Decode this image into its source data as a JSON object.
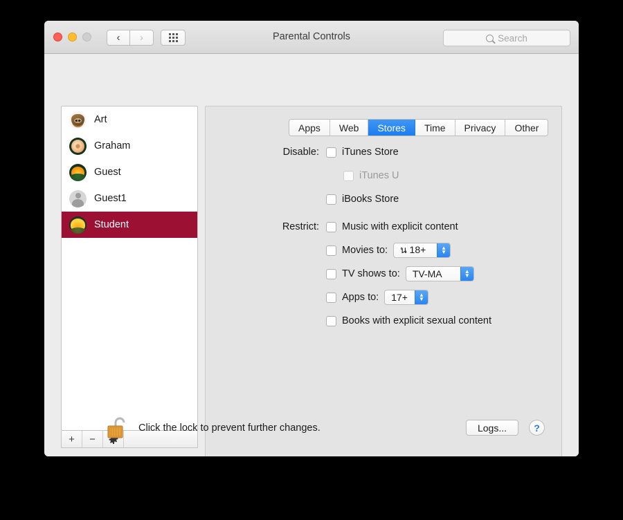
{
  "window": {
    "title": "Parental Controls",
    "traffic_lights": [
      "close",
      "minimize",
      "zoom"
    ],
    "nav_back_icon": "chevron-left-icon",
    "nav_forward_icon": "chevron-right-icon",
    "grid_icon": "show-all-grid-icon"
  },
  "search": {
    "placeholder": "Search",
    "value": "",
    "icon": "search-icon"
  },
  "sidebar": {
    "users": [
      {
        "name": "Art",
        "avatar": "cat-avatar",
        "selected": false
      },
      {
        "name": "Graham",
        "avatar": "rose-avatar",
        "selected": false
      },
      {
        "name": "Guest",
        "avatar": "poppy-avatar",
        "selected": false
      },
      {
        "name": "Guest1",
        "avatar": "person-avatar",
        "selected": false
      },
      {
        "name": "Student",
        "avatar": "sunflower-avatar",
        "selected": true
      }
    ],
    "selection_color": "#9c1033",
    "toolbar": {
      "add_label": "+",
      "remove_label": "−",
      "action_icon": "gear-icon"
    }
  },
  "tabs": [
    {
      "label": "Apps",
      "active": false
    },
    {
      "label": "Web",
      "active": false
    },
    {
      "label": "Stores",
      "active": true
    },
    {
      "label": "Time",
      "active": false
    },
    {
      "label": "Privacy",
      "active": false
    },
    {
      "label": "Other",
      "active": false
    }
  ],
  "tab_active_color": "#1d7ded",
  "stores": {
    "disable_label": "Disable:",
    "disable_items": [
      {
        "label": "iTunes Store",
        "checked": false,
        "enabled": true,
        "indented": false
      },
      {
        "label": "iTunes U",
        "checked": false,
        "enabled": false,
        "indented": true
      },
      {
        "label": "iBooks Store",
        "checked": false,
        "enabled": true,
        "indented": false
      }
    ],
    "restrict_label": "Restrict:",
    "restrict_items": [
      {
        "label": "Music with explicit content",
        "checked": false,
        "popup": null
      },
      {
        "label": "Movies to:",
        "checked": false,
        "popup": "น 18+"
      },
      {
        "label": "TV shows to:",
        "checked": false,
        "popup": "TV-MA"
      },
      {
        "label": "Apps to:",
        "checked": false,
        "popup": "17+"
      },
      {
        "label": "Books with explicit sexual content",
        "checked": false,
        "popup": null
      }
    ]
  },
  "footer": {
    "lock_icon": "unlocked-padlock-icon",
    "lock_text": "Click the lock to prevent further changes.",
    "logs_label": "Logs...",
    "help_label": "?"
  }
}
